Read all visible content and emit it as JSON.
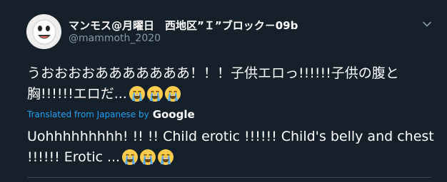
{
  "tweet": {
    "display_name": "マンモス@月曜日　西地区”Ｉ”ブロック－09b",
    "handle": "@mammoth_2020",
    "original_text": "うおおおおあああああああ！！！子供エロっ!!!!!!子供の腹と胸!!!!!!エロだ...",
    "translated_by_label": "Translated from Japanese by",
    "translator": "Google",
    "translated_text": "Uohhhhhhhhh! !! !! Child erotic !!!!!! Child's belly and chest !!!!!! Erotic ...",
    "emoji": "loudly-crying-face",
    "emoji_count": 3
  },
  "icons": {
    "caret": "chevron-down-icon",
    "avatar": "cartoon-face-avatar"
  },
  "colors": {
    "background": "#15202b",
    "text": "#ffffff",
    "secondary_text": "#8899a6",
    "link": "#1da1f2",
    "divider": "#38444d",
    "emoji_face": "#ffcc4d",
    "emoji_tears": "#5dadec"
  }
}
